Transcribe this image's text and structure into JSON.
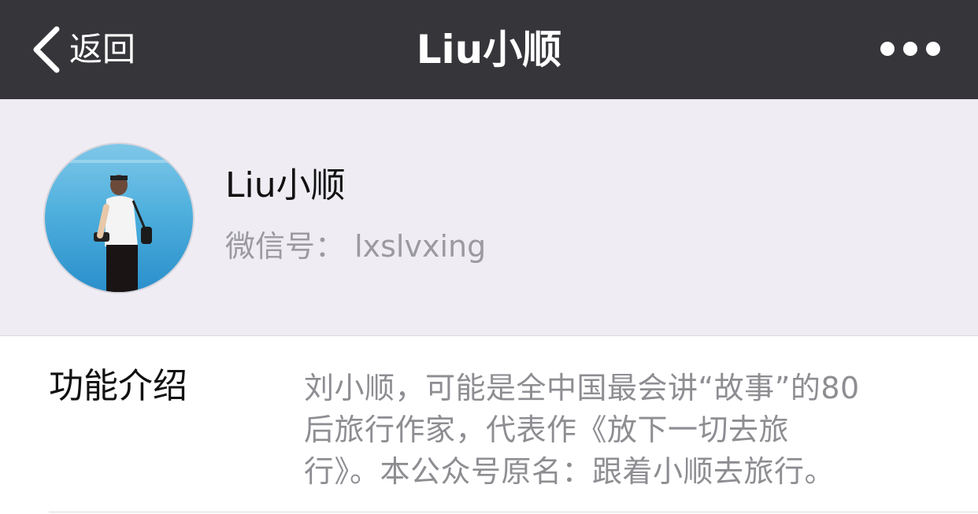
{
  "nav": {
    "back_label": "返回",
    "title": "Liu小顺",
    "more_icon": "ellipsis-icon",
    "background": "#36353a"
  },
  "profile": {
    "name": "Liu小顺",
    "wechat_id_label": "微信号：",
    "wechat_id": "lxslvxing",
    "wechat_id_full": "微信号：  lxslvxing",
    "background": "#efedf3"
  },
  "intro": {
    "label": "功能介绍",
    "lines": [
      "刘小顺，可能是全中国最会讲“故事”的80",
      "后旅行作家，代表作《放下一切去旅",
      "行》。本公众号原名：跟着小顺去旅行。"
    ]
  }
}
